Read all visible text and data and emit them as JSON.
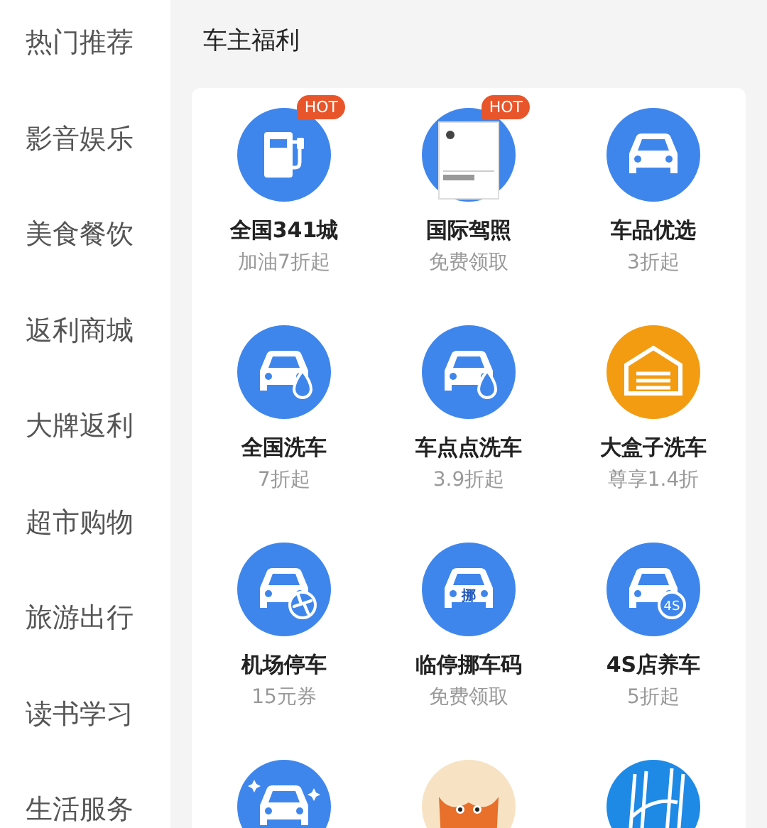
{
  "sidebar": {
    "items": [
      {
        "label": "热门推荐"
      },
      {
        "label": "影音娱乐"
      },
      {
        "label": "美食餐饮"
      },
      {
        "label": "返利商城"
      },
      {
        "label": "大牌返利"
      },
      {
        "label": "超市购物"
      },
      {
        "label": "旅游出行"
      },
      {
        "label": "读书学习"
      },
      {
        "label": "生活服务"
      }
    ]
  },
  "section": {
    "title": "车主福利",
    "items": [
      {
        "kind": "fuel",
        "badge": "HOT",
        "title": "全国341城",
        "subtitle": "加油7折起"
      },
      {
        "kind": "license",
        "badge": "HOT",
        "title": "国际驾照",
        "subtitle": "免费领取"
      },
      {
        "kind": "car",
        "title": "车品优选",
        "subtitle": "3折起"
      },
      {
        "kind": "wash",
        "title": "全国洗车",
        "subtitle": "7折起"
      },
      {
        "kind": "wash",
        "title": "车点点洗车",
        "subtitle": "3.9折起"
      },
      {
        "kind": "garage",
        "title": "大盒子洗车",
        "subtitle": "尊享1.4折"
      },
      {
        "kind": "plane",
        "title": "机场停车",
        "subtitle": "15元券"
      },
      {
        "kind": "move",
        "mark": "挪",
        "title": "临停挪车码",
        "subtitle": "免费领取"
      },
      {
        "kind": "service",
        "mark": "4S",
        "title": "4S店养车",
        "subtitle": "5折起"
      },
      {
        "kind": "sparkle"
      },
      {
        "kind": "mascot"
      },
      {
        "kind": "logo"
      }
    ]
  }
}
